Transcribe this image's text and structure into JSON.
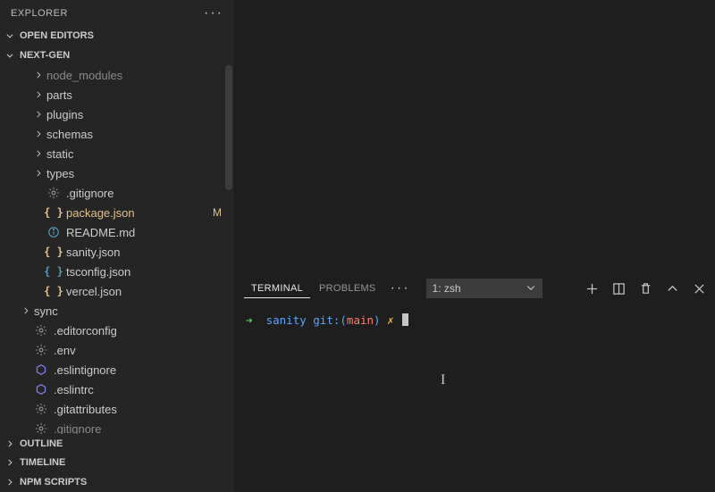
{
  "explorer": {
    "title": "EXPLORER",
    "sections": {
      "open_editors": "OPEN EDITORS",
      "project": "NEXT-GEN",
      "outline": "OUTLINE",
      "timeline": "TIMELINE",
      "npm_scripts": "NPM SCRIPTS"
    }
  },
  "tree": [
    {
      "name": "node_modules",
      "kind": "folder",
      "indent": 2,
      "truncated": true
    },
    {
      "name": "parts",
      "kind": "folder",
      "indent": 2
    },
    {
      "name": "plugins",
      "kind": "folder",
      "indent": 2
    },
    {
      "name": "schemas",
      "kind": "folder",
      "indent": 2
    },
    {
      "name": "static",
      "kind": "folder",
      "indent": 2
    },
    {
      "name": "types",
      "kind": "folder",
      "indent": 2
    },
    {
      "name": ".gitignore",
      "kind": "file",
      "indent": 2,
      "icon": "gear"
    },
    {
      "name": "package.json",
      "kind": "file",
      "indent": 2,
      "icon": "braces-yellow",
      "status": "M",
      "modified": true
    },
    {
      "name": "README.md",
      "kind": "file",
      "indent": 2,
      "icon": "info"
    },
    {
      "name": "sanity.json",
      "kind": "file",
      "indent": 2,
      "icon": "braces-yellow"
    },
    {
      "name": "tsconfig.json",
      "kind": "file",
      "indent": 2,
      "icon": "braces-blue"
    },
    {
      "name": "vercel.json",
      "kind": "file",
      "indent": 2,
      "icon": "braces-yellow"
    },
    {
      "name": "sync",
      "kind": "folder",
      "indent": 1
    },
    {
      "name": ".editorconfig",
      "kind": "file",
      "indent": 1,
      "icon": "gear"
    },
    {
      "name": ".env",
      "kind": "file",
      "indent": 1,
      "icon": "gear"
    },
    {
      "name": ".eslintignore",
      "kind": "file",
      "indent": 1,
      "icon": "eslint"
    },
    {
      "name": ".eslintrc",
      "kind": "file",
      "indent": 1,
      "icon": "eslint"
    },
    {
      "name": ".gitattributes",
      "kind": "file",
      "indent": 1,
      "icon": "gear"
    },
    {
      "name": ".gitignore",
      "kind": "file",
      "indent": 1,
      "icon": "gear",
      "truncated": true
    }
  ],
  "panel": {
    "tabs": {
      "terminal": "TERMINAL",
      "problems": "PROBLEMS"
    },
    "active_tab": "terminal",
    "shell_selector": "1: zsh"
  },
  "terminal": {
    "prompt": {
      "arrow": "➜",
      "dir": "sanity",
      "git_prefix": "git:(",
      "branch": "main",
      "git_suffix": ")",
      "dirty": "✗"
    }
  }
}
